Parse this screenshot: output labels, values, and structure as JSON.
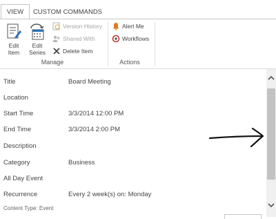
{
  "ribbon": {
    "tabs": [
      {
        "label": "VIEW",
        "active": true
      },
      {
        "label": "CUSTOM COMMANDS",
        "active": false
      }
    ],
    "manage": {
      "group_label": "Manage",
      "edit_item": "Edit\nItem",
      "edit_item_l1": "Edit",
      "edit_item_l2": "Item",
      "edit_series_l1": "Edit",
      "edit_series_l2": "Series",
      "version_history": "Version History",
      "shared_with": "Shared With",
      "delete_item": "Delete Item"
    },
    "actions": {
      "group_label": "Actions",
      "alert_me": "Alert Me",
      "workflows": "Workflows"
    }
  },
  "fields": [
    {
      "label": "Title",
      "value": "Board Meeting"
    },
    {
      "label": "Location",
      "value": ""
    },
    {
      "label": "Start Time",
      "value": "3/3/2014 12:00 PM"
    },
    {
      "label": "End Time",
      "value": "3/3/2014 2:00 PM"
    },
    {
      "label": "Description",
      "value": ""
    },
    {
      "label": "Category",
      "value": "Business"
    },
    {
      "label": "All Day Event",
      "value": ""
    },
    {
      "label": "Recurrence",
      "value": "Every 2 week(s) on: Monday"
    }
  ],
  "content_type": "Content Type: Event",
  "colors": {
    "accent_blue": "#2a6fb6",
    "disabled": "#a6a6a6",
    "alert_orange": "#e07a1f",
    "workflow_red": "#c0392b"
  }
}
